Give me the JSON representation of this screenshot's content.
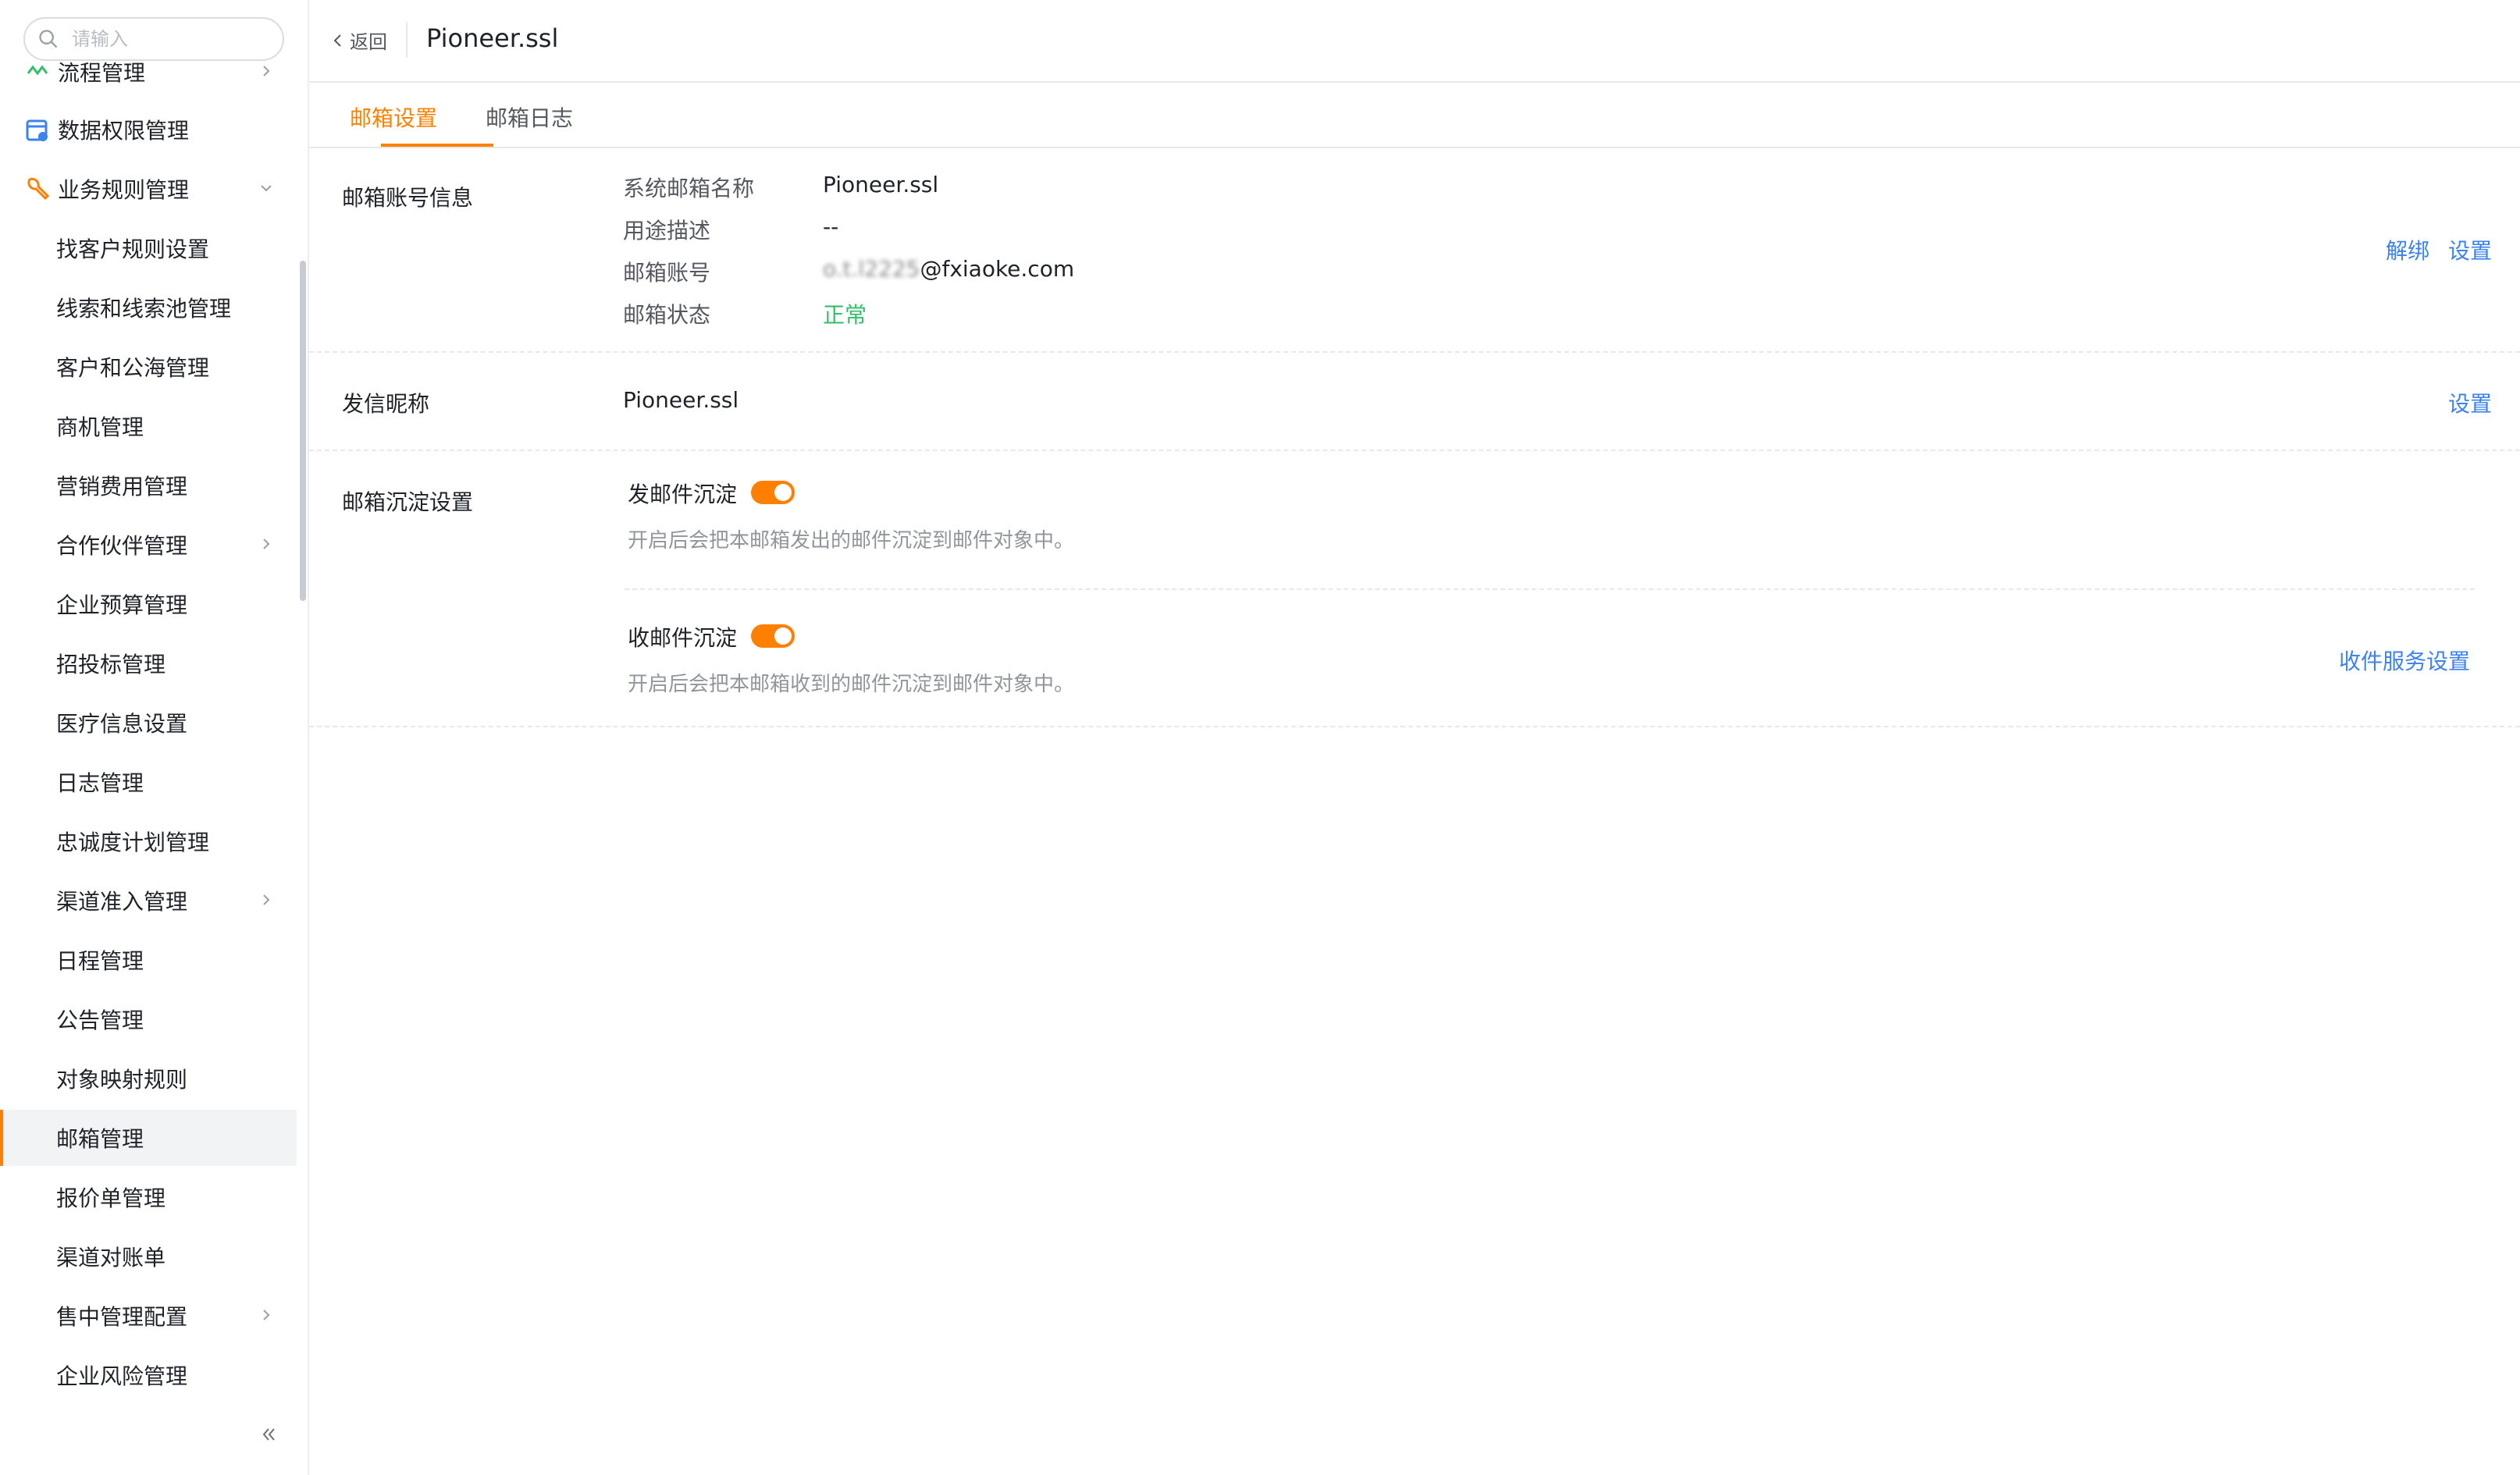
{
  "sidebar": {
    "search_placeholder": "请输入",
    "items": [
      {
        "label": "流程管理"
      },
      {
        "label": "数据权限管理"
      },
      {
        "label": "业务规则管理"
      },
      {
        "label": "找客户规则设置"
      },
      {
        "label": "线索和线索池管理"
      },
      {
        "label": "客户和公海管理"
      },
      {
        "label": "商机管理"
      },
      {
        "label": "营销费用管理"
      },
      {
        "label": "合作伙伴管理"
      },
      {
        "label": "企业预算管理"
      },
      {
        "label": "招投标管理"
      },
      {
        "label": "医疗信息设置"
      },
      {
        "label": "日志管理"
      },
      {
        "label": "忠诚度计划管理"
      },
      {
        "label": "渠道准入管理"
      },
      {
        "label": "日程管理"
      },
      {
        "label": "公告管理"
      },
      {
        "label": "对象映射规则"
      },
      {
        "label": "邮箱管理"
      },
      {
        "label": "报价单管理"
      },
      {
        "label": "渠道对账单"
      },
      {
        "label": "售中管理配置"
      },
      {
        "label": "企业风险管理"
      }
    ]
  },
  "header": {
    "back_label": "返回",
    "title": "Pioneer.ssl"
  },
  "tabs": [
    {
      "label": "邮箱设置"
    },
    {
      "label": "邮箱日志"
    }
  ],
  "account_info": {
    "section_title": "邮箱账号信息",
    "rows": [
      {
        "label": "系统邮箱名称",
        "value": "Pioneer.ssl"
      },
      {
        "label": "用途描述",
        "value": "--"
      },
      {
        "label": "邮箱账号",
        "value_masked": "o.t.l2225",
        "value_suffix": "@fxiaoke.com"
      },
      {
        "label": "邮箱状态",
        "value": "正常"
      }
    ],
    "unbind_label": "解绑",
    "settings_label": "设置"
  },
  "sender_nickname": {
    "section_title": "发信昵称",
    "value": "Pioneer.ssl",
    "settings_label": "设置"
  },
  "archive_settings": {
    "section_title": "邮箱沉淀设置",
    "send_archive": {
      "label": "发邮件沉淀",
      "enabled": true,
      "hint": "开启后会把本邮箱发出的邮件沉淀到邮件对象中。"
    },
    "receive_archive": {
      "label": "收邮件沉淀",
      "enabled": true,
      "hint": "开启后会把本邮箱收到的邮件沉淀到邮件对象中。"
    },
    "receive_service_label": "收件服务设置"
  },
  "colors": {
    "accent": "#ff8000",
    "link": "#3c82f0",
    "status_ok": "#30c06a"
  }
}
